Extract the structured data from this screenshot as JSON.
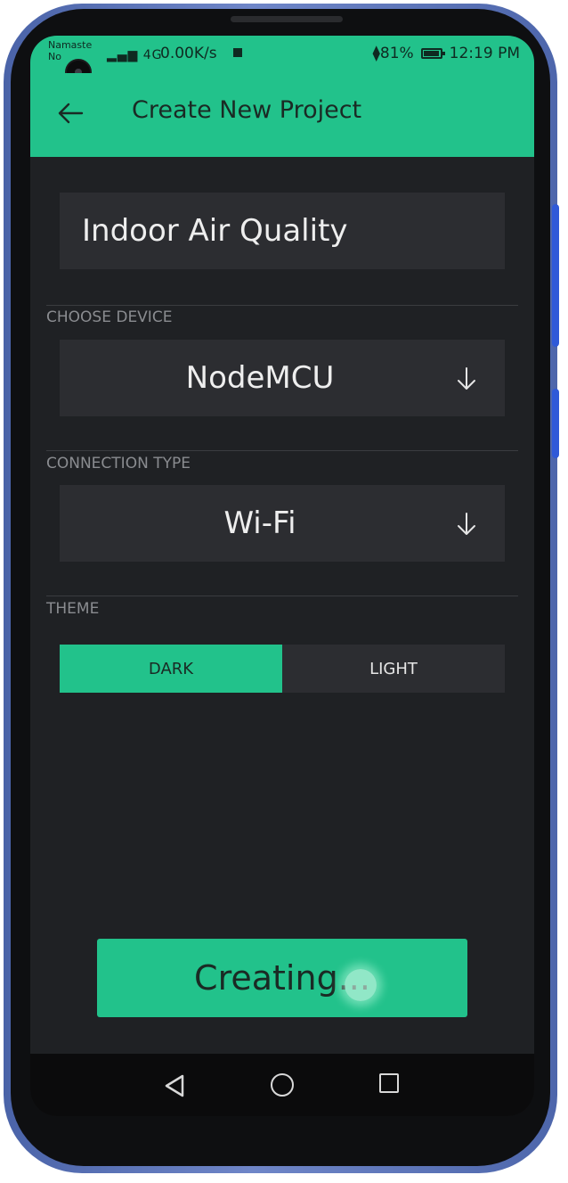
{
  "status_bar": {
    "carrier": "Namaste No",
    "network_signal": "▂▄▆ 4G",
    "net_speed": "0.00K/s",
    "vibrate_battery": "⧫81%",
    "time": "12:19 PM"
  },
  "app_bar": {
    "back_icon": "arrow-left-icon",
    "title": "Create New Project"
  },
  "form": {
    "project_name": "Indoor Air Quality",
    "device_label": "CHOOSE DEVICE",
    "device_value": "NodeMCU",
    "connection_label": "CONNECTION TYPE",
    "connection_value": "Wi-Fi",
    "theme_label": "THEME",
    "theme_options": [
      "DARK",
      "LIGHT"
    ],
    "theme_selected": "DARK"
  },
  "create_button": {
    "label": "Creating..."
  },
  "colors": {
    "accent": "#22c28b",
    "background": "#1f2124",
    "field": "#2c2d31",
    "phone_frame": "#5a74b8"
  },
  "nav_bar": {
    "icons": [
      "nav-back-icon",
      "nav-home-icon",
      "nav-recents-icon"
    ]
  }
}
